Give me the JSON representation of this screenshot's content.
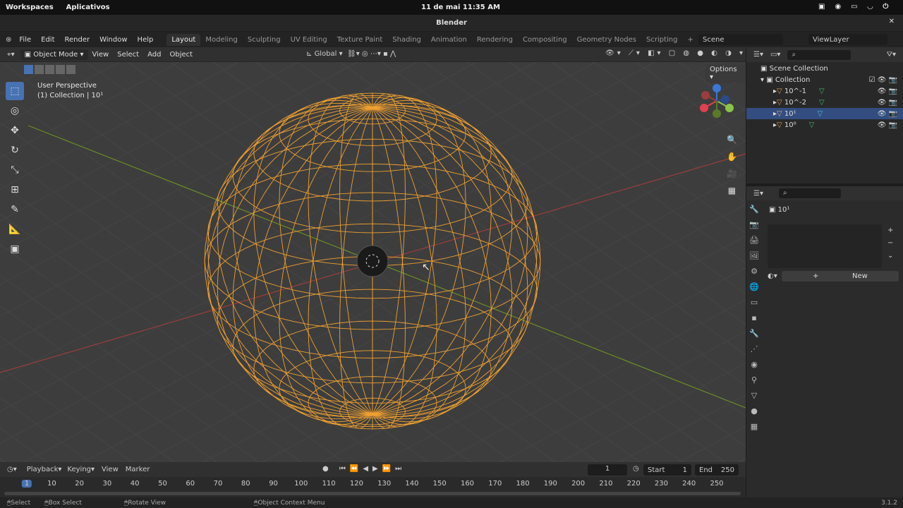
{
  "os": {
    "workspaces": "Workspaces",
    "apps": "Aplicativos",
    "clock": "11 de mai  11:35 AM"
  },
  "window": {
    "title": "Blender"
  },
  "menu": {
    "items": [
      "File",
      "Edit",
      "Render",
      "Window",
      "Help"
    ],
    "tabs": [
      "Layout",
      "Modeling",
      "Sculpting",
      "UV Editing",
      "Texture Paint",
      "Shading",
      "Animation",
      "Rendering",
      "Compositing",
      "Geometry Nodes",
      "Scripting"
    ],
    "scene": "Scene",
    "view_layer": "ViewLayer"
  },
  "viewport_header": {
    "mode": "Object Mode",
    "menus": [
      "View",
      "Select",
      "Add",
      "Object"
    ],
    "orientation": "Global",
    "options": "Options"
  },
  "viewport": {
    "perspective": "User Perspective",
    "collection": "(1) Collection | 10¹",
    "sphere_color": "#f0a030",
    "x_axis_color": "#9c3d3d",
    "y_axis_color": "#6b8e23"
  },
  "outliner": {
    "root": "Scene Collection",
    "collection": "Collection",
    "items": [
      "10^-1",
      "10^-2",
      "10¹",
      "10⁰"
    ],
    "selected": 2
  },
  "properties": {
    "object": "10¹",
    "new_label": "New"
  },
  "timeline": {
    "menus": [
      "Playback",
      "Keying",
      "View",
      "Marker"
    ],
    "current_frame": "1",
    "start_label": "Start",
    "start": "1",
    "end_label": "End",
    "end": "250",
    "ticks": [
      "1",
      "10",
      "20",
      "30",
      "40",
      "50",
      "60",
      "70",
      "80",
      "90",
      "100",
      "110",
      "120",
      "130",
      "140",
      "150",
      "160",
      "170",
      "180",
      "190",
      "200",
      "210",
      "220",
      "230",
      "240",
      "250"
    ]
  },
  "status": {
    "select": "Select",
    "box_select": "Box Select",
    "rotate": "Rotate View",
    "context": "Object Context Menu",
    "version": "3.1.2"
  }
}
